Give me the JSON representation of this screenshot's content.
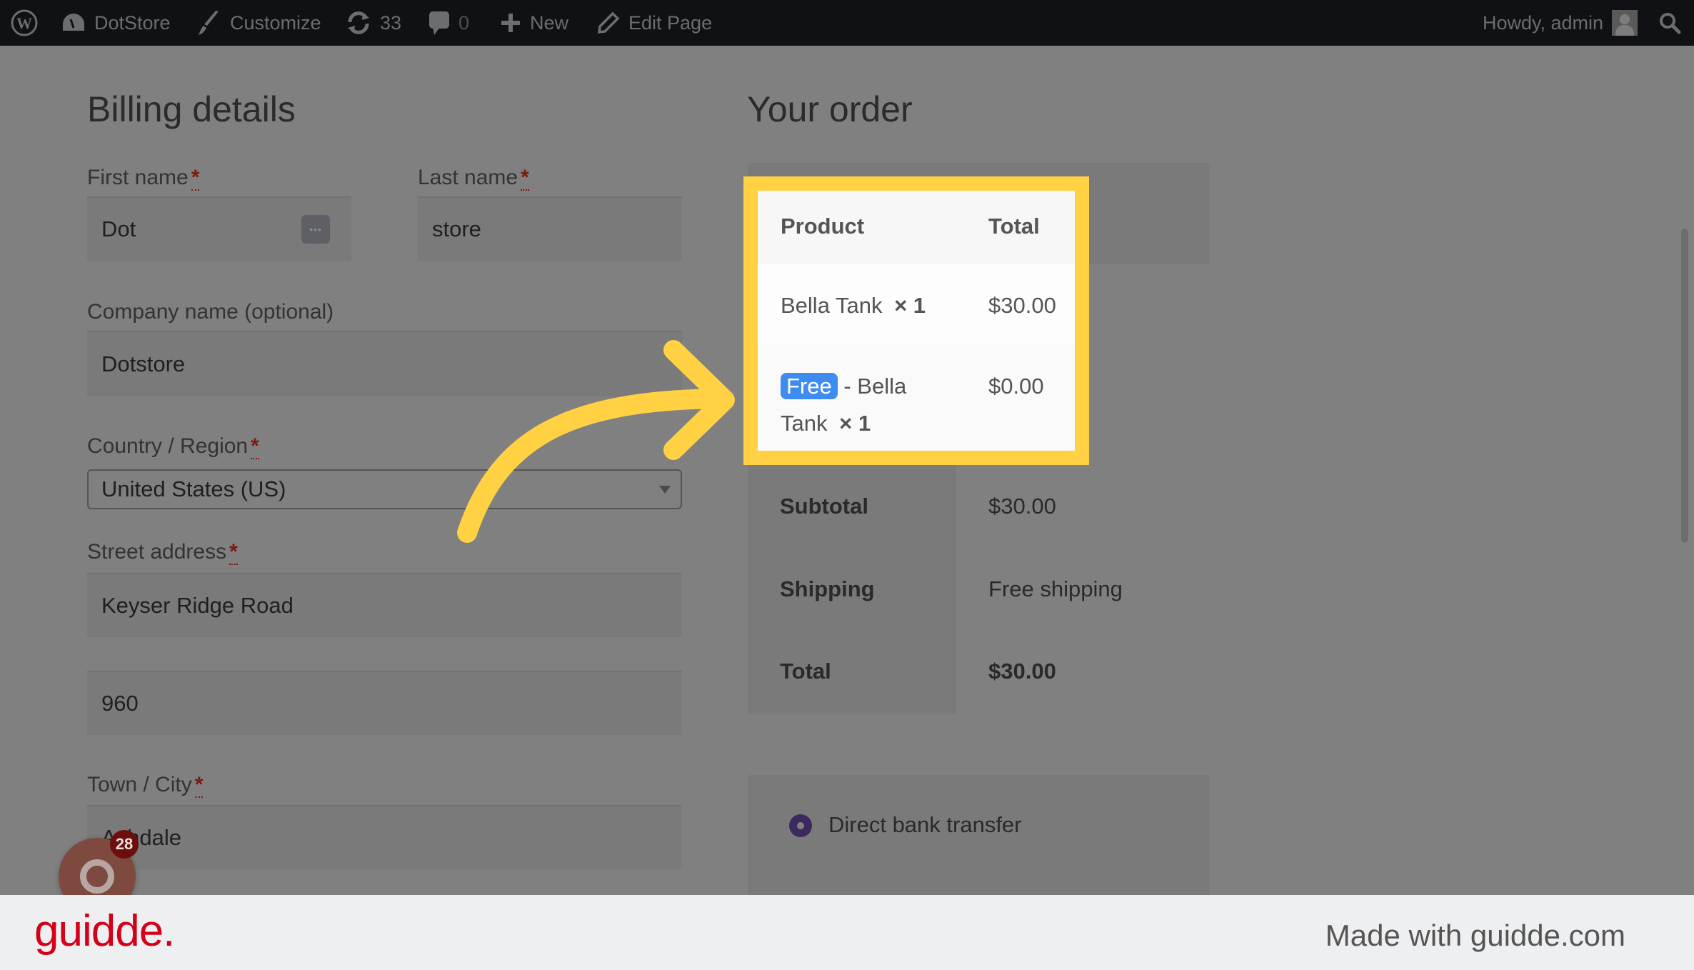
{
  "admin_bar": {
    "site_name": "DotStore",
    "customize_label": "Customize",
    "updates_count": "33",
    "comments_count": "0",
    "new_label": "New",
    "edit_page_label": "Edit Page",
    "howdy_label": "Howdy, admin"
  },
  "billing": {
    "title": "Billing details",
    "required_marker": "*",
    "first_name": {
      "label": "First name",
      "value": "Dot"
    },
    "last_name": {
      "label": "Last name",
      "value": "store"
    },
    "company": {
      "label": "Company name (optional)",
      "value": "Dotstore"
    },
    "country": {
      "label": "Country / Region",
      "value": "United States (US)"
    },
    "street": {
      "label": "Street address",
      "line1": "Keyser Ridge Road",
      "line2": "960"
    },
    "city": {
      "label": "Town / City",
      "value": "Ashdale"
    }
  },
  "order": {
    "title": "Your order",
    "headers": {
      "product": "Product",
      "total": "Total"
    },
    "items": [
      {
        "name": "Bella Tank",
        "qty": "× 1",
        "total": "$30.00"
      },
      {
        "badge": "Free",
        "name_line1": "- Bella",
        "name_line2": "Tank",
        "qty": "× 1",
        "total": "$0.00"
      }
    ],
    "subtotal": {
      "label": "Subtotal",
      "value": "$30.00"
    },
    "shipping": {
      "label": "Shipping",
      "value": "Free shipping"
    },
    "total": {
      "label": "Total",
      "value": "$30.00"
    },
    "payment_methods": [
      {
        "label": "Direct bank transfer",
        "selected": true
      }
    ]
  },
  "guidde": {
    "notification_count": "28",
    "logo_text": "guidde.",
    "made_with": "Made with guidde.com"
  },
  "colors": {
    "highlight": "#ffd143",
    "free_badge": "#3f8cf1",
    "guidde_brand": "#d4001a",
    "radio_selected": "#3c2a5e"
  }
}
